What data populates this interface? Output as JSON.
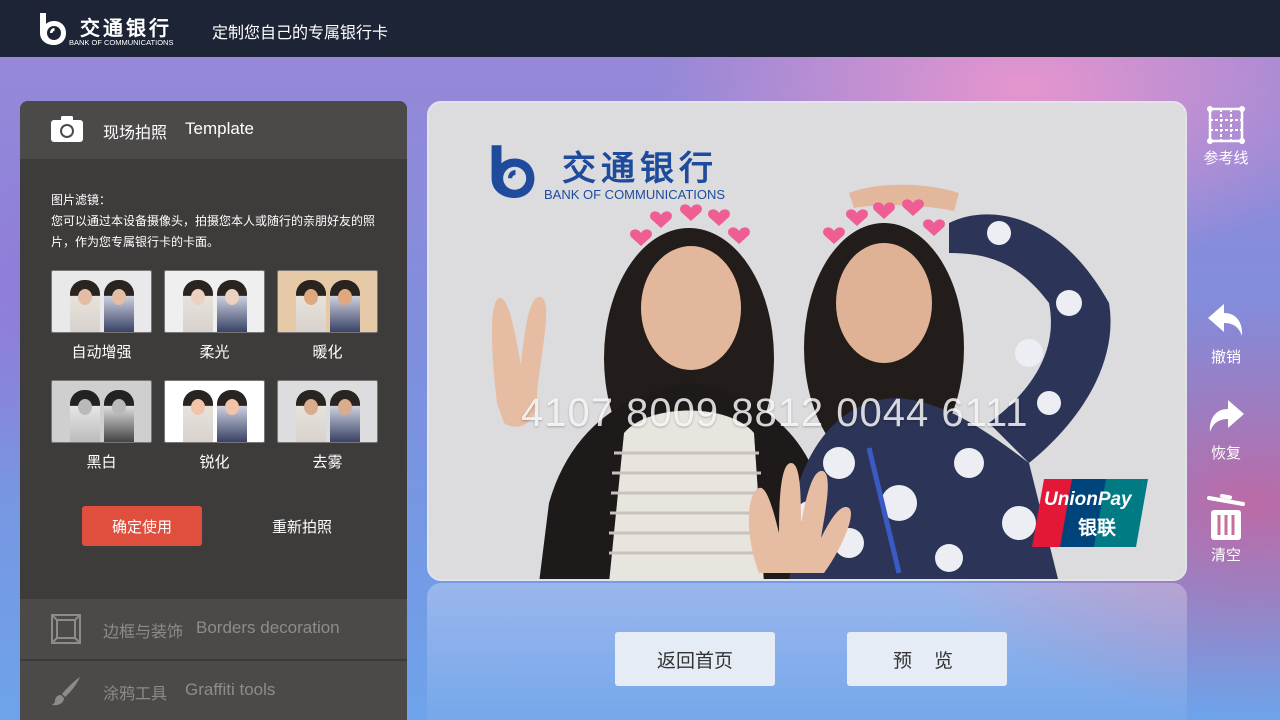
{
  "header": {
    "logo_cn": "交通银行",
    "logo_en": "BANK OF COMMUNICATIONS",
    "title": "定制您自己的专属银行卡"
  },
  "panel": {
    "photo_section": {
      "icon": "camera-icon",
      "label_cn": "现场拍照",
      "label_en": "Template"
    },
    "filter_title": "图片滤镜：",
    "filter_description": "您可以通过本设备摄像头，拍摄您本人或随行的亲朋好友的照片，作为您专属银行卡的卡面。",
    "filters": [
      {
        "label": "自动增强",
        "tone": "#e9e9ec",
        "face": "#e3bda4"
      },
      {
        "label": "柔光",
        "tone": "#efefef",
        "face": "#ecd0c0"
      },
      {
        "label": "暖化",
        "tone": "#e6caa8",
        "face": "#e0a87f"
      },
      {
        "label": "黑白",
        "tone": "#cfcfcf",
        "face": "#b9b9b9"
      },
      {
        "label": "锐化",
        "tone": "#ffffff",
        "face": "#f0c4a8"
      },
      {
        "label": "去雾",
        "tone": "#dddde0",
        "face": "#d8ac8e"
      }
    ],
    "confirm_label": "确定使用",
    "retake_label": "重新拍照",
    "borders_section": {
      "icon": "frame-icon",
      "label_cn": "边框与装饰",
      "label_en": "Borders  decoration"
    },
    "graffiti_section": {
      "icon": "brush-icon",
      "label_cn": "涂鸦工具",
      "label_en": "Graffiti tools"
    }
  },
  "card": {
    "bank_name_cn": "交通银行",
    "bank_name_en": "BANK OF COMMUNICATIONS",
    "number": "4107 8009 8812 0044 6111",
    "network_en": "UnionPay",
    "network_cn": "银联"
  },
  "actions": {
    "home_label": "返回首页",
    "preview_label": "预 览"
  },
  "toolbar": {
    "guides": "参考线",
    "undo": "撤销",
    "redo": "恢复",
    "clear": "清空"
  },
  "colors": {
    "accent": "#e04f3e",
    "topbar": "#1d2436",
    "panel": "#3e3b3b",
    "bank_blue": "#1e4b9c"
  }
}
